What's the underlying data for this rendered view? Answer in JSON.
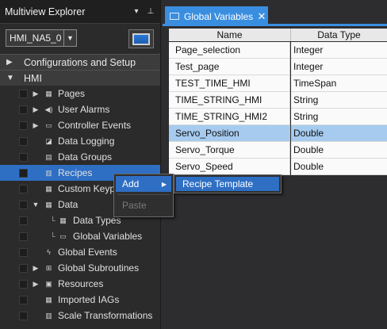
{
  "explorer": {
    "title": "Multiview Explorer",
    "pin_icon": "pin-icon",
    "device": {
      "value": "HMI_NA5_0"
    },
    "sections": {
      "config": "Configurations and Setup",
      "hmi": "HMI"
    },
    "tree": [
      {
        "label": "Pages",
        "icon": "pages-icon"
      },
      {
        "label": "User Alarms",
        "icon": "alarm-icon"
      },
      {
        "label": "Controller Events",
        "icon": "events-icon"
      },
      {
        "label": "Data Logging",
        "icon": "datalog-icon"
      },
      {
        "label": "Data Groups",
        "icon": "datagroup-icon"
      },
      {
        "label": "Recipes",
        "icon": "recipe-icon"
      },
      {
        "label": "Custom Keyp",
        "icon": "keypad-icon"
      },
      {
        "label": "Data",
        "icon": "data-icon"
      },
      {
        "label": "Data Types",
        "icon": "datatypes-icon"
      },
      {
        "label": "Global Variables",
        "icon": "globalvars-icon"
      },
      {
        "label": "Global Events",
        "icon": "lightning-icon"
      },
      {
        "label": "Global Subroutines",
        "icon": "subroutine-icon"
      },
      {
        "label": "Resources",
        "icon": "resources-icon"
      },
      {
        "label": "Imported IAGs",
        "icon": "iag-icon"
      },
      {
        "label": "Scale Transformations",
        "icon": "scale-icon"
      }
    ]
  },
  "tab": {
    "title": "Global Variables",
    "icon_text": "local"
  },
  "grid": {
    "columns": [
      "Name",
      "Data Type"
    ],
    "rows": [
      {
        "name": "Page_selection",
        "type": "Integer"
      },
      {
        "name": "Test_page",
        "type": "Integer"
      },
      {
        "name": "TEST_TIME_HMI",
        "type": "TimeSpan"
      },
      {
        "name": "TIME_STRING_HMI",
        "type": "String"
      },
      {
        "name": "TIME_STRING_HMI2",
        "type": "String"
      },
      {
        "name": "Servo_Position",
        "type": "Double"
      },
      {
        "name": "Servo_Torque",
        "type": "Double"
      },
      {
        "name": "Servo_Speed",
        "type": "Double"
      }
    ]
  },
  "context_menu": {
    "add": "Add",
    "paste": "Paste",
    "submenu_item": "Recipe Template"
  },
  "colors": {
    "accent": "#3a8ee0",
    "selection": "#2e6fc4",
    "row_selected": "#a6cbef"
  }
}
